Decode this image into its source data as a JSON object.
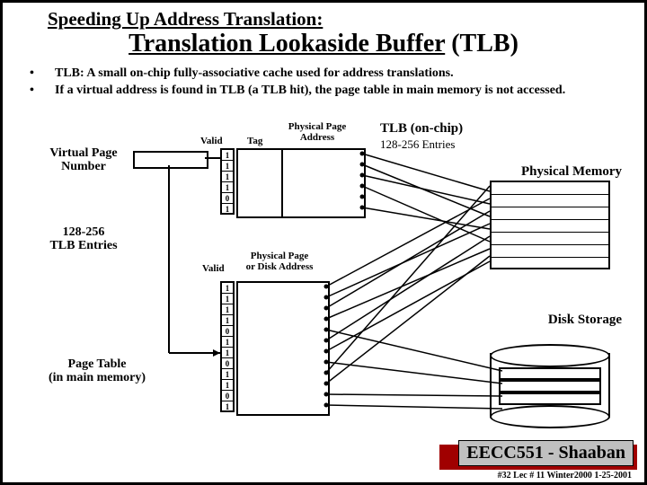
{
  "title_line1": "Speeding Up Address Translation:",
  "title_line2_pre": "Translation Lookaside Buffer",
  "title_line2_post": " (TLB)",
  "bullets": [
    "TLB: A small on-chip fully-associative cache used for address translations.",
    "If a virtual address is found in TLB  (a TLB hit), the page table in main memory is not accessed."
  ],
  "labels": {
    "vpn": "Virtual Page\nNumber",
    "tlb_entries": "128-256\nTLB Entries",
    "page_table": "Page Table\n(in main memory)",
    "valid1": "Valid",
    "valid2": "Valid",
    "tag": "Tag",
    "ppa": "Physical Page\nAddress",
    "tlb_onchip": "TLB  (on-chip)",
    "tlb_onchip_sub": "128-256 Entries",
    "phys_mem": "Physical Memory",
    "ppda": "Physical Page\nor Disk Address",
    "disk": "Disk Storage"
  },
  "tlb_valid_bits": [
    "1",
    "1",
    "1",
    "1",
    "0",
    "1"
  ],
  "pt_valid_bits": [
    "1",
    "1",
    "1",
    "1",
    "0",
    "1",
    "1",
    "0",
    "1",
    "1",
    "0",
    "1"
  ],
  "footer": {
    "main": "EECC551 - Shaaban",
    "sub": "#32  Lec # 11   Winter2000  1-25-2001"
  }
}
